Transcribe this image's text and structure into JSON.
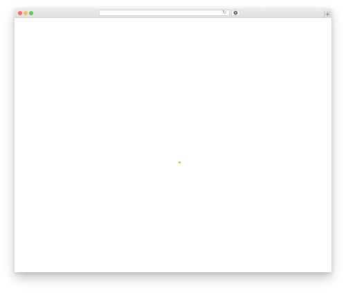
{
  "browser": {
    "traffic_lights": {
      "close_color": "#f06a5f",
      "minimize_color": "#f5bf4f",
      "maximize_color": "#62c454"
    },
    "address_bar": {
      "url": "",
      "reload_icon": "reload-icon",
      "reload_glyph": "↻"
    },
    "extension_icon": "gear-icon",
    "new_tab_icon": "plus-icon",
    "new_tab_glyph": "+"
  },
  "page": {
    "background": "#ffffff",
    "loader": {
      "icon": "loading-dot",
      "color": "#b5cc18"
    }
  }
}
